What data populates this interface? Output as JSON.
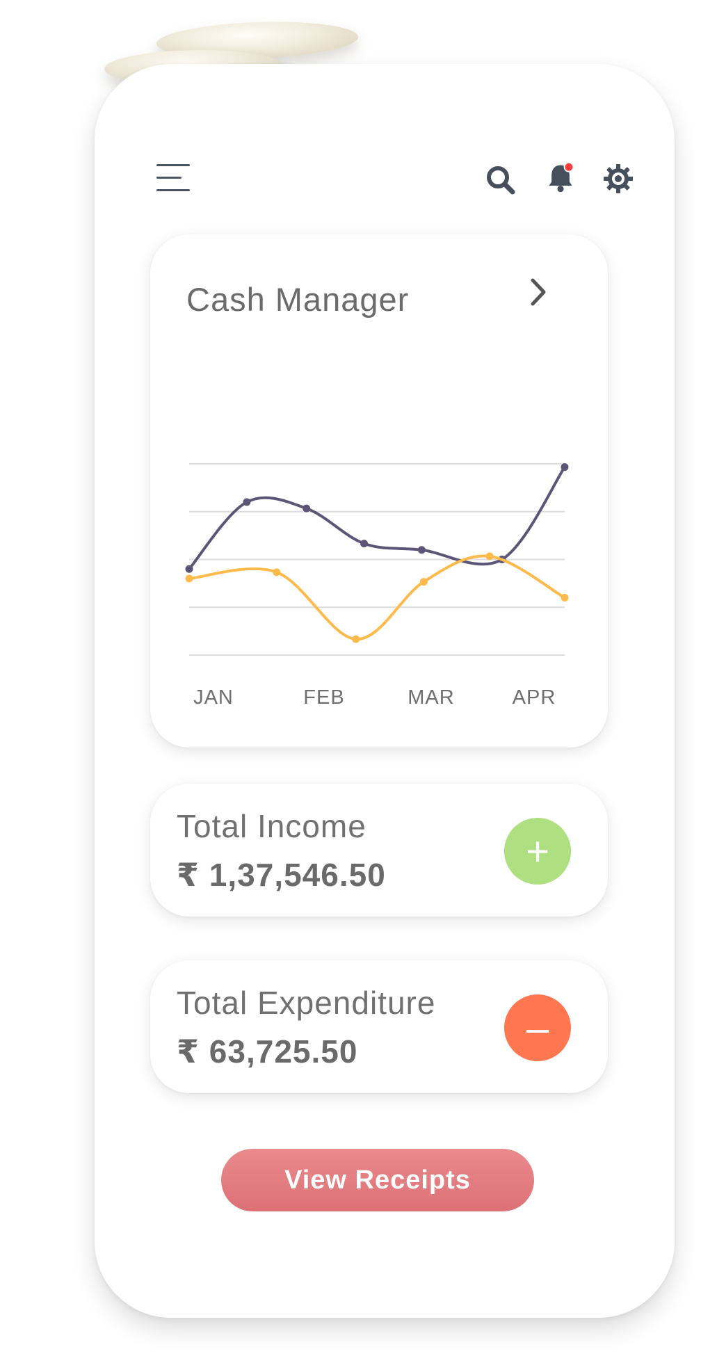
{
  "header": {
    "icons": [
      "menu-icon",
      "search-icon",
      "bell-icon",
      "settings-icon"
    ],
    "notification_dot_color": "#ff3b3b"
  },
  "cash_manager": {
    "title": "Cash Manager",
    "chevron_icon": "chevron-right-icon"
  },
  "chart_data": {
    "type": "line",
    "categories": [
      "JAN",
      "FEB",
      "MAR",
      "APR"
    ],
    "grid": true,
    "legend": "none",
    "series": [
      {
        "color": "#5c5577",
        "x": [
          0,
          0.56,
          1.14,
          1.7,
          2.26,
          3.04,
          3.65
        ],
        "values": [
          4.7,
          6.8,
          6.6,
          5.5,
          5.3,
          5.0,
          7.9
        ]
      },
      {
        "color": "#ffba4c",
        "x": [
          0,
          0.85,
          1.62,
          2.28,
          2.92,
          3.65
        ],
        "values": [
          4.4,
          4.6,
          2.5,
          4.3,
          5.1,
          3.8
        ]
      }
    ]
  },
  "income": {
    "label": "Total Income",
    "value": "₹ 1,37,546.50",
    "button_symbol": "+",
    "button_icon": "plus-icon",
    "color": "#aee082"
  },
  "expenditure": {
    "label": "Total Expenditure",
    "value": "₹ 63,725.50",
    "button_symbol": "–",
    "button_icon": "minus-icon",
    "color": "#ff7750"
  },
  "actions": {
    "view_receipts": "View Receipts"
  }
}
